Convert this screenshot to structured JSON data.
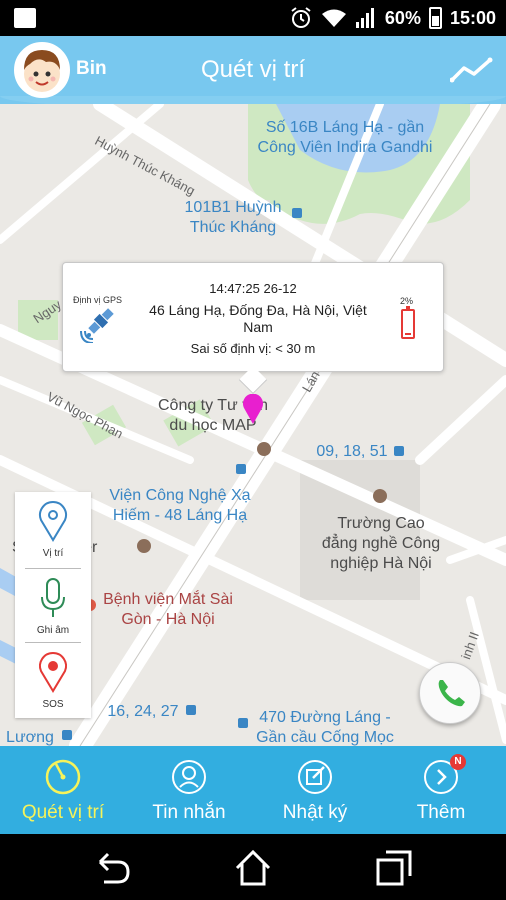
{
  "status_bar": {
    "battery_percent": "60%",
    "time": "15:00",
    "icons": [
      "notification-square-icon",
      "alarm-icon",
      "wifi-icon",
      "signal-icon",
      "battery-icon"
    ]
  },
  "header": {
    "user_name": "Bin",
    "title": "Quét vị trí",
    "right_icon": "trend-line-icon"
  },
  "map": {
    "labels": {
      "street_huynh": "Huỳnh Thúc Kháng",
      "place_so16b": "Số 16B Láng Hạ - gần Công Viên Indira Gandhi",
      "place_101b1": "101B1 Huỳnh Thúc Kháng",
      "street_nguy": "Nguy",
      "street_vu": "Vũ Ngọc Phan",
      "street_lang": "Lán",
      "place_congty": "Công ty Tư vấn du học MAP",
      "place_bus1": "09, 18, 51",
      "place_vien": "Viện Công Nghệ Xạ Hiếm - 48 Láng Hạ",
      "place_tower": "S         ower",
      "place_truong": "Trường Cao đẳng nghề Công nghiệp Hà Nội",
      "place_benhvien": "Bệnh viện Mắt Sài Gòn - Hà Nội",
      "place_bus2": "16, 24, 27",
      "place_luong": "Lương",
      "place_470": "470 Đường Láng - Gần cầu Cống Mọc",
      "street_dinh": "inh II"
    }
  },
  "popup": {
    "time": "14:47:25 26-12",
    "gps_label": "Định vị GPS",
    "address": "46 Láng Hạ, Đống Đa, Hà Nội, Việt Nam",
    "error": "Sai số định vị:  < 30 m",
    "battery_label": "2%"
  },
  "side_panel": {
    "location_label": "Vị trí",
    "record_label": "Ghi âm",
    "sos_label": "SOS"
  },
  "bottom_nav": {
    "items": [
      {
        "label": "Quét vị trí",
        "icon": "scan-location-icon"
      },
      {
        "label": "Tin nhắn",
        "icon": "message-icon"
      },
      {
        "label": "Nhật ký",
        "icon": "diary-icon"
      },
      {
        "label": "Thêm",
        "icon": "more-icon",
        "badge": "N"
      }
    ]
  },
  "colors": {
    "header": "#78c8ef",
    "nav_bg": "#32aee0",
    "nav_active": "#f6f35a",
    "pin": "#e81fcf",
    "park": "#cfe8c2",
    "water": "#a9cdf2"
  }
}
